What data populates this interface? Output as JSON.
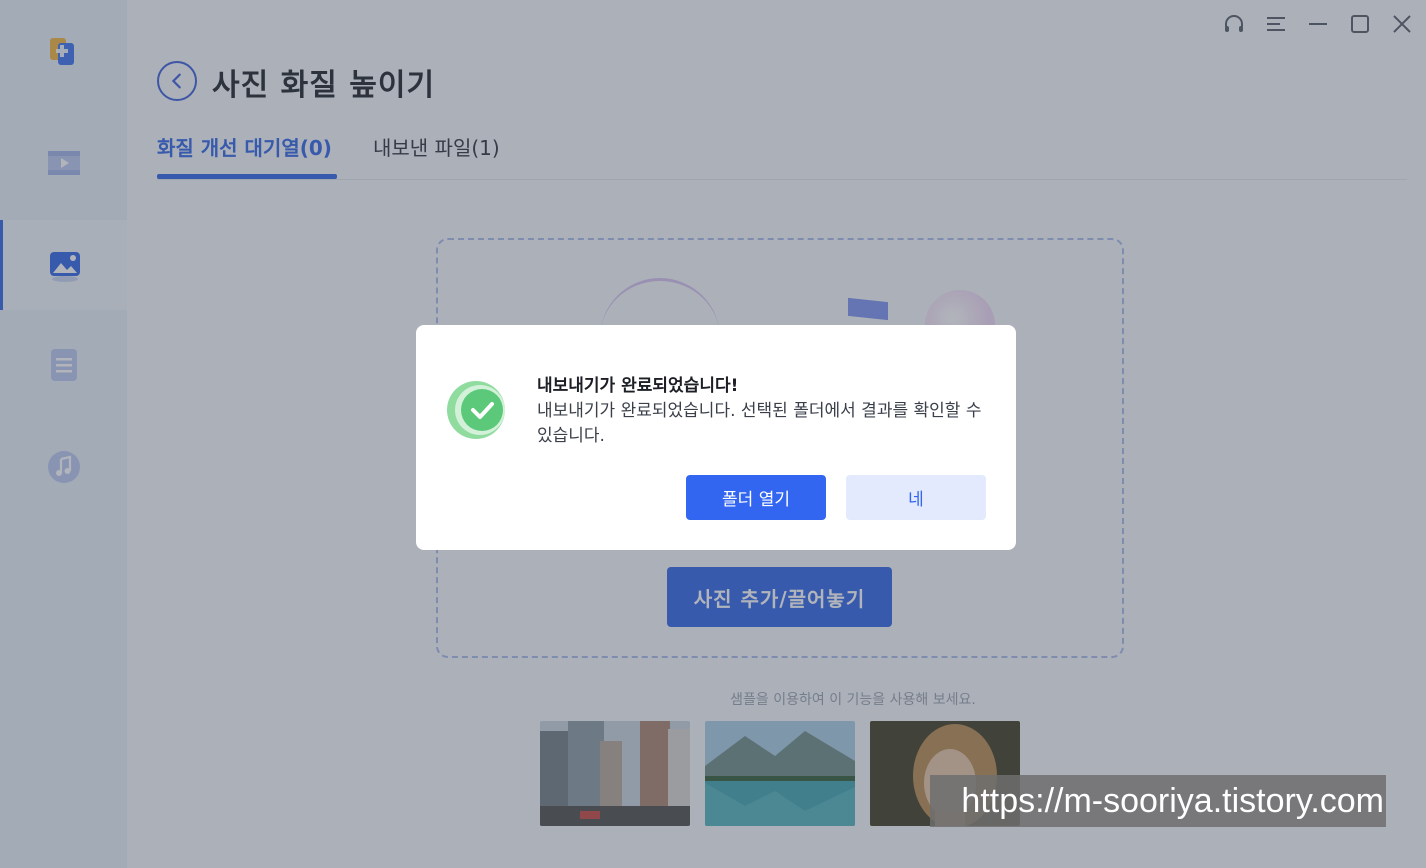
{
  "page": {
    "title": "사진 화질 높이기"
  },
  "tabs": [
    {
      "label": "화질 개선 대기열(0)",
      "active": true
    },
    {
      "label": "내보낸 파일(1)",
      "active": false
    }
  ],
  "sidebar": {
    "items": [
      {
        "icon": "video-icon"
      },
      {
        "icon": "photo-icon",
        "active": true
      },
      {
        "icon": "document-icon"
      },
      {
        "icon": "music-icon"
      }
    ]
  },
  "window_controls": [
    "headset-icon",
    "menu-icon",
    "minimize-icon",
    "maximize-icon",
    "close-icon"
  ],
  "dropzone": {
    "add_button": "사진 추가/끌어놓기"
  },
  "samples": {
    "caption": "샘플을 이용하여 이 기능을 사용해 보세요.",
    "images": [
      "city-photo",
      "lake-mountain-photo",
      "portrait-photo"
    ]
  },
  "dialog": {
    "title": "내보내기가 완료되었습니다!",
    "message": "내보내기가 완료되었습니다. 선택된 폴더에서 결과를 확인할 수 있습니다.",
    "open_folder": "폴더 열기",
    "confirm": "네"
  },
  "watermark": "https://m-sooriya.tistory.com",
  "colors": {
    "accent": "#2f62e6",
    "success": "#5cc97a"
  }
}
